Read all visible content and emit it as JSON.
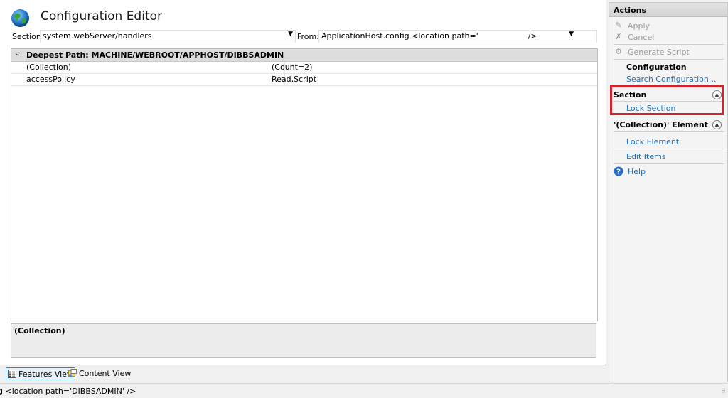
{
  "header": {
    "title": "Configuration Editor"
  },
  "toolbar": {
    "section_label": "Section:",
    "section_value": "system.webServer/handlers",
    "from_label": "From:",
    "from_value": "ApplicationHost.config <location path='                    />"
  },
  "grid": {
    "path_header": "Deepest Path: MACHINE/WEBROOT/APPHOST/DIBBSADMIN",
    "rows": [
      {
        "name": "(Collection)",
        "value": "(Count=2)"
      },
      {
        "name": "accessPolicy",
        "value": "Read,Script"
      }
    ]
  },
  "description": {
    "title": "(Collection)"
  },
  "view_tabs": {
    "features": "Features View",
    "content": "Content View"
  },
  "status": {
    "text": "g <location path='DIBBSADMIN' />"
  },
  "actions": {
    "title": "Actions",
    "apply": "Apply",
    "cancel": "Cancel",
    "generate_script": "Generate Script",
    "configuration_heading": "Configuration",
    "search_configuration": "Search Configuration...",
    "section_group": "Section",
    "lock_section": "Lock Section",
    "element_group": "'(Collection)' Element",
    "lock_element": "Lock Element",
    "edit_items": "Edit Items",
    "help": "Help"
  },
  "colors": {
    "link": "#1e6fbf",
    "highlight": "#d8202a",
    "disabled": "#9a9a9a"
  }
}
